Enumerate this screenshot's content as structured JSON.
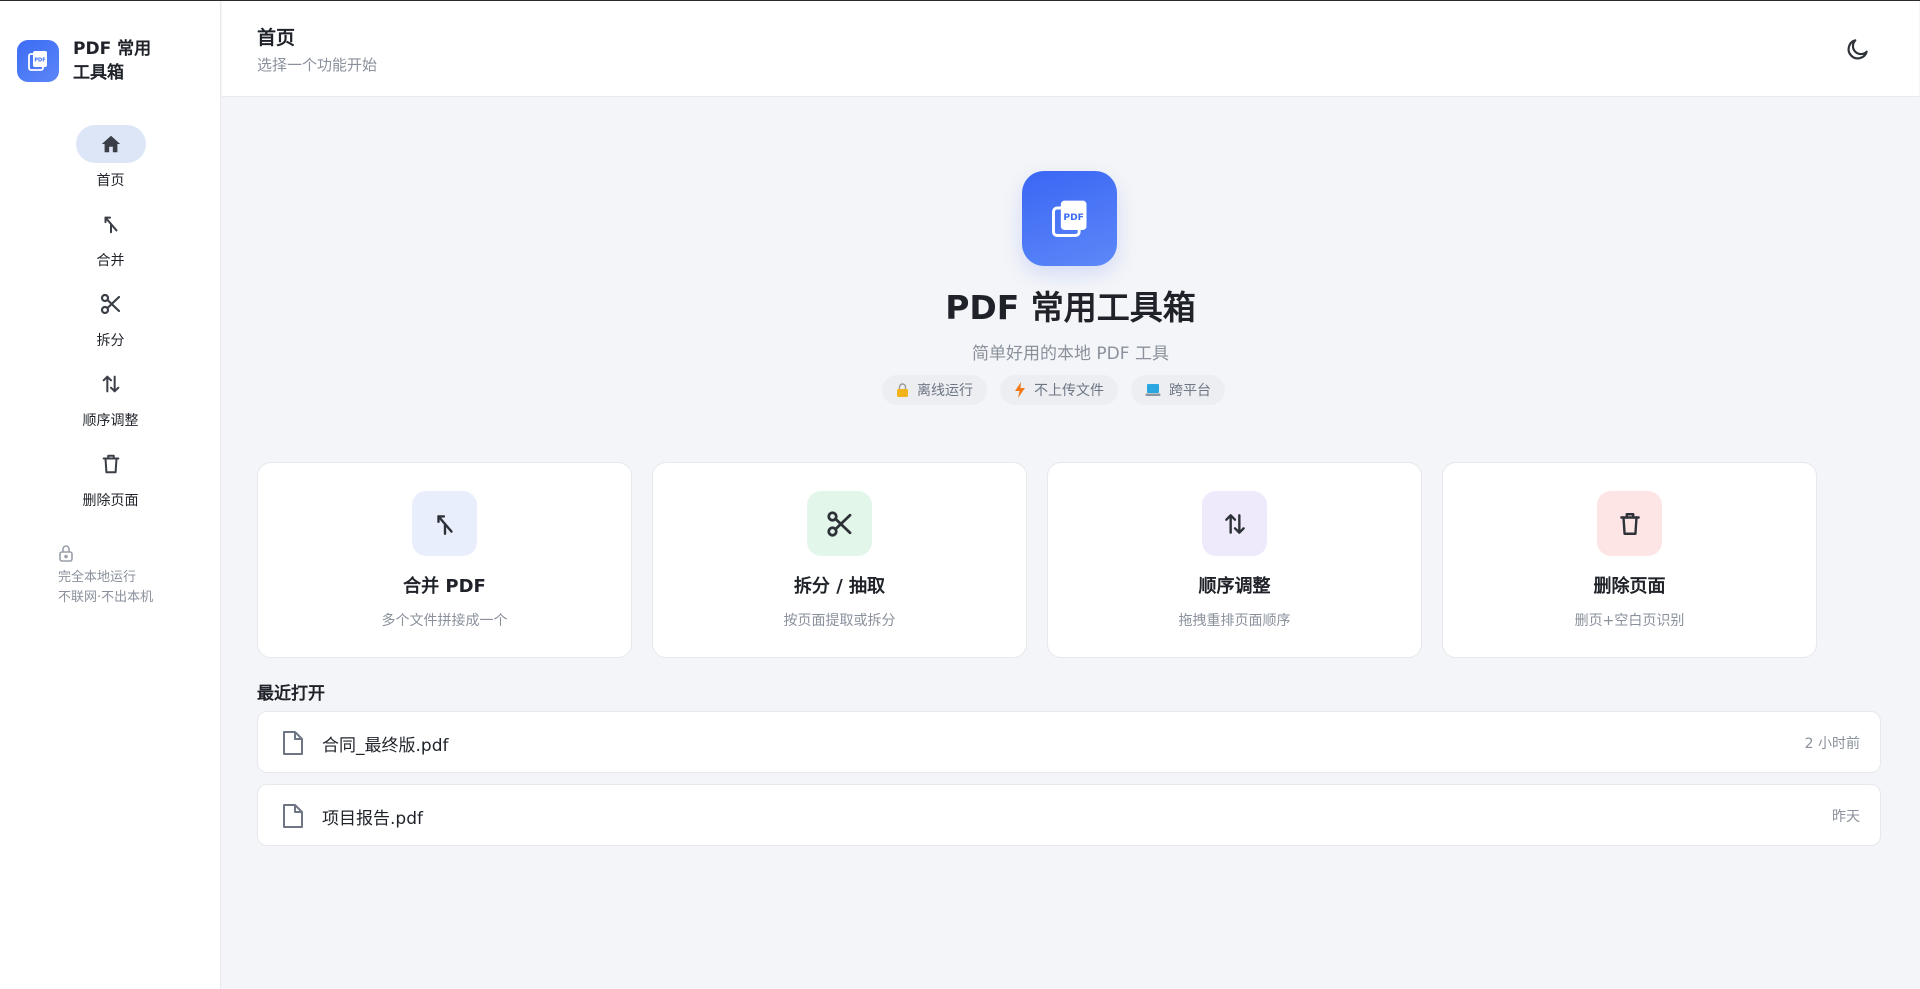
{
  "app": {
    "brand_line1": "PDF 常用",
    "brand_line2": "工具箱",
    "logo_text": "PDF"
  },
  "sidebar": {
    "items": [
      {
        "label": "首页",
        "icon": "home-icon",
        "active": true
      },
      {
        "label": "合并",
        "icon": "merge-icon"
      },
      {
        "label": "拆分",
        "icon": "scissors-icon"
      },
      {
        "label": "顺序调整",
        "icon": "reorder-icon"
      },
      {
        "label": "删除页面",
        "icon": "trash-icon"
      }
    ],
    "note": {
      "line1": "完全本地运行",
      "line2": "不联网·不出本机",
      "icon": "lock-icon"
    }
  },
  "header": {
    "title": "首页",
    "subtitle": "选择一个功能开始",
    "theme_icon": "moon-icon"
  },
  "hero": {
    "title": "PDF 常用工具箱",
    "subtitle": "简单好用的本地 PDF 工具",
    "tags": [
      {
        "label": "离线运行",
        "icon": "lock-emoji-icon"
      },
      {
        "label": "不上传文件",
        "icon": "lightning-icon"
      },
      {
        "label": "跨平台",
        "icon": "laptop-icon"
      }
    ]
  },
  "cards": [
    {
      "title": "合并 PDF",
      "desc": "多个文件拼接成一个",
      "icon": "merge-icon",
      "bg": "#e8eefc"
    },
    {
      "title": "拆分 / 抽取",
      "desc": "按页面提取或拆分",
      "icon": "scissors-icon",
      "bg": "#e3f6ea"
    },
    {
      "title": "顺序调整",
      "desc": "拖拽重排页面顺序",
      "icon": "reorder-icon",
      "bg": "#efe9fc"
    },
    {
      "title": "删除页面",
      "desc": "删页+空白页识别",
      "icon": "trash-icon",
      "bg": "#fde5e5"
    }
  ],
  "recent": {
    "title": "最近打开",
    "files": [
      {
        "name": "合同_最终版.pdf",
        "time": "2 小时前"
      },
      {
        "name": "项目报告.pdf",
        "time": "昨天"
      }
    ]
  },
  "colors": {
    "accent": "#3d6cf6",
    "active_nav_bg": "#dde6f7",
    "muted_text": "#8a919c"
  }
}
